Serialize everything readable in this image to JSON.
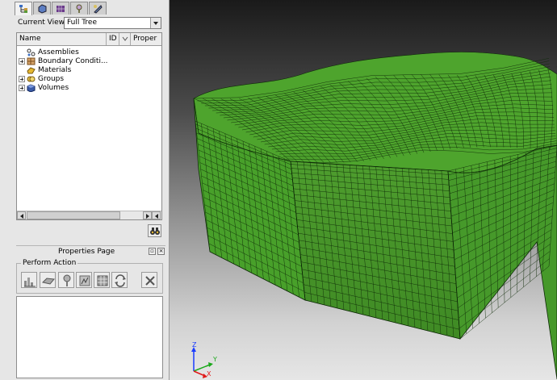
{
  "tabs": [
    {
      "icon": "model-tree-icon",
      "active": true
    },
    {
      "icon": "geometry-icon"
    },
    {
      "icon": "mesh-icon"
    },
    {
      "icon": "tools-icon"
    },
    {
      "icon": "analysis-icon"
    }
  ],
  "current_view": {
    "label": "Current View",
    "value": "Full Tree"
  },
  "tree": {
    "columns": [
      "Name",
      "ID",
      "Proper"
    ],
    "items": [
      {
        "label": "Assemblies",
        "icon": "assemblies-icon",
        "expandable": false
      },
      {
        "label": "Boundary Conditi...",
        "icon": "boundary-conditions-icon",
        "expandable": true
      },
      {
        "label": "Materials",
        "icon": "materials-icon",
        "expandable": false
      },
      {
        "label": "Groups",
        "icon": "groups-icon",
        "expandable": true
      },
      {
        "label": "Volumes",
        "icon": "volumes-icon",
        "expandable": true
      }
    ]
  },
  "properties_page": {
    "title": "Properties Page",
    "perform_action": "Perform Action"
  },
  "axes": {
    "z": "Z",
    "y": "Y",
    "x": "X"
  },
  "colors": {
    "mesh_green": "#4aa42a",
    "mesh_line": "#0e2a08"
  }
}
